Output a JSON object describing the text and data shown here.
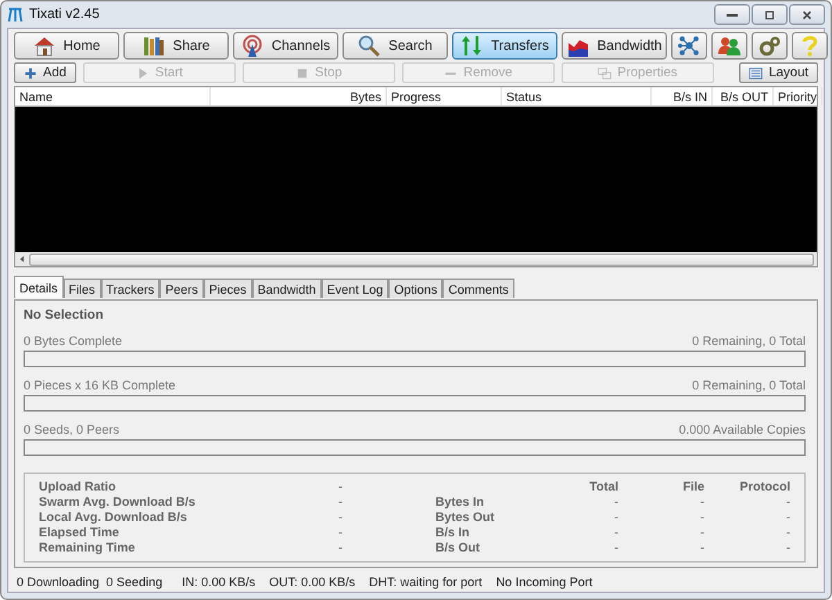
{
  "window": {
    "title": "Tixati v2.45"
  },
  "nav": [
    {
      "label": "Home",
      "selected": false
    },
    {
      "label": "Share",
      "selected": false
    },
    {
      "label": "Channels",
      "selected": false
    },
    {
      "label": "Search",
      "selected": false
    },
    {
      "label": "Transfers",
      "selected": true
    },
    {
      "label": "Bandwidth",
      "selected": false
    },
    {
      "selected": false
    },
    {
      "selected": false
    },
    {
      "selected": false
    },
    {
      "selected": false
    }
  ],
  "toolbar": [
    {
      "label": "Add",
      "disabled": false
    },
    {
      "label": "Start",
      "disabled": true
    },
    {
      "label": "Stop",
      "disabled": true
    },
    {
      "label": "Remove",
      "disabled": true
    },
    {
      "label": "Properties",
      "disabled": true
    },
    {
      "label": "Layout",
      "disabled": false
    }
  ],
  "table": {
    "columns": [
      "Name",
      "Bytes",
      "Progress",
      "Status",
      "B/s IN",
      "B/s OUT",
      "Priority"
    ]
  },
  "detail_tabs": [
    {
      "label": "Details",
      "selected": true
    },
    {
      "label": "Files",
      "selected": false
    },
    {
      "label": "Trackers",
      "selected": false
    },
    {
      "label": "Peers",
      "selected": false
    },
    {
      "label": "Pieces",
      "selected": false
    },
    {
      "label": "Bandwidth",
      "selected": false
    },
    {
      "label": "Event Log",
      "selected": false
    },
    {
      "label": "Options",
      "selected": false
    },
    {
      "label": "Comments",
      "selected": false
    }
  ],
  "details": {
    "title": "No Selection",
    "bars": [
      {
        "left": "0 Bytes Complete",
        "right": "0 Remaining,  0 Total",
        "level": 0
      },
      {
        "left": "0 Pieces  x  16 KB Complete",
        "right": "0 Remaining,  0 Total",
        "level": 0
      },
      {
        "left": "0 Seeds, 0 Peers",
        "right": "0.000 Available Copies",
        "level": 0
      }
    ],
    "stats": [
      {
        "label": "Upload Ratio",
        "value": "-"
      },
      {
        "label": "Swarm Avg. Download B/s",
        "value": "-"
      },
      {
        "label": "Local Avg. Download B/s",
        "value": "-"
      },
      {
        "label": "Elapsed Time",
        "value": "-"
      },
      {
        "label": "Remaining Time",
        "value": "-"
      }
    ],
    "traffic_columns": [
      "Total",
      "File",
      "Protocol"
    ],
    "traffic": [
      {
        "label": "Bytes In",
        "values": [
          "-",
          "-",
          "-"
        ]
      },
      {
        "label": "Bytes Out",
        "values": [
          "-",
          "-",
          "-"
        ]
      },
      {
        "label": "B/s In",
        "values": [
          "-",
          "-",
          "-"
        ]
      },
      {
        "label": "B/s Out",
        "values": [
          "-",
          "-",
          "-"
        ]
      }
    ]
  },
  "status_bar": [
    "0 Downloading",
    "0 Seeding",
    "IN: 0.00 KB/s",
    "OUT: 0.00 KB/s",
    "DHT: waiting for port",
    "No Incoming Port"
  ]
}
